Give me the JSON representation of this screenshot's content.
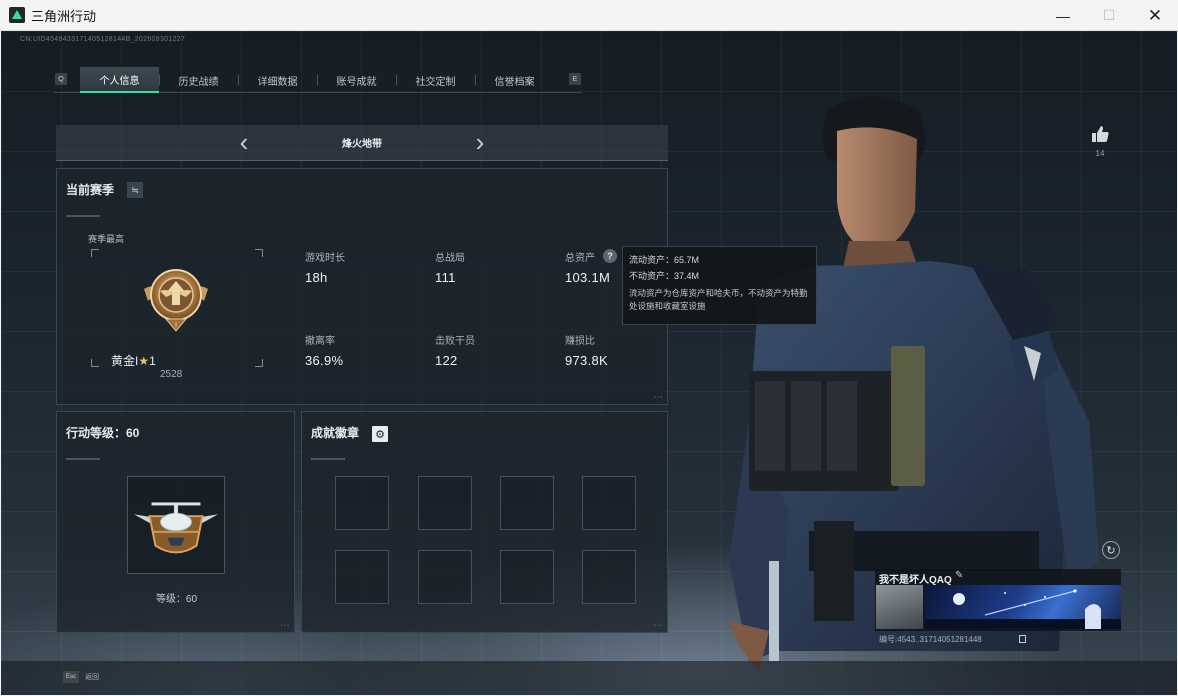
{
  "window": {
    "title": "三角洲行动",
    "minimize": "—",
    "maximize": "☐",
    "close": "✕"
  },
  "uid_text": "CN:UID4549433171405128144B_202608301227",
  "tabs": {
    "key_left": "Q",
    "key_right": "E",
    "items": [
      {
        "label": "个人信息",
        "active": true
      },
      {
        "label": "历史战绩",
        "active": false
      },
      {
        "label": "详细数据",
        "active": false
      },
      {
        "label": "账号成就",
        "active": false
      },
      {
        "label": "社交定制",
        "active": false
      },
      {
        "label": "信誉档案",
        "active": false
      }
    ]
  },
  "mode": {
    "prev": "‹",
    "label": "烽火地带",
    "next": "›"
  },
  "season": {
    "title": "当前赛季",
    "swap_icon": "≒",
    "best_label": "赛季最高",
    "rank_name": "黄金I",
    "rank_star": "★",
    "rank_star_count": "1",
    "rank_points": "2528",
    "stats": [
      {
        "label": "游戏时长",
        "value": "18h"
      },
      {
        "label": "总战局",
        "value": "111"
      },
      {
        "label": "总资产",
        "value": "103.1M"
      },
      {
        "label": "撤离率",
        "value": "36.9%"
      },
      {
        "label": "击败干员",
        "value": "122"
      },
      {
        "label": "赚损比",
        "value": "973.8K"
      }
    ],
    "help_icon": "?"
  },
  "tooltip": {
    "liquid": "流动资产：65.7M",
    "fixed": "不动资产：37.4M",
    "desc": "流动资产为仓库资产和哈夫币，不动资产为特勤处设施和收藏室设施"
  },
  "level": {
    "title": "行动等级：60",
    "text": "等级：60"
  },
  "achievements": {
    "title": "成就徽章",
    "gear_icon": "⚙",
    "slots": 8
  },
  "likes": {
    "icon": "👍",
    "count": "14"
  },
  "refresh_icon": "↻",
  "player": {
    "name": "我不是坏人QAQ",
    "edit_icon": "✎",
    "id_text": "编号:4543..31714051281448"
  },
  "footer": {
    "esc_key": "Esc",
    "back_label": "返回"
  },
  "colors": {
    "accent": "#2fe39a",
    "panel_bg": "#1c242b",
    "rank_gold": "#c99a5a"
  }
}
